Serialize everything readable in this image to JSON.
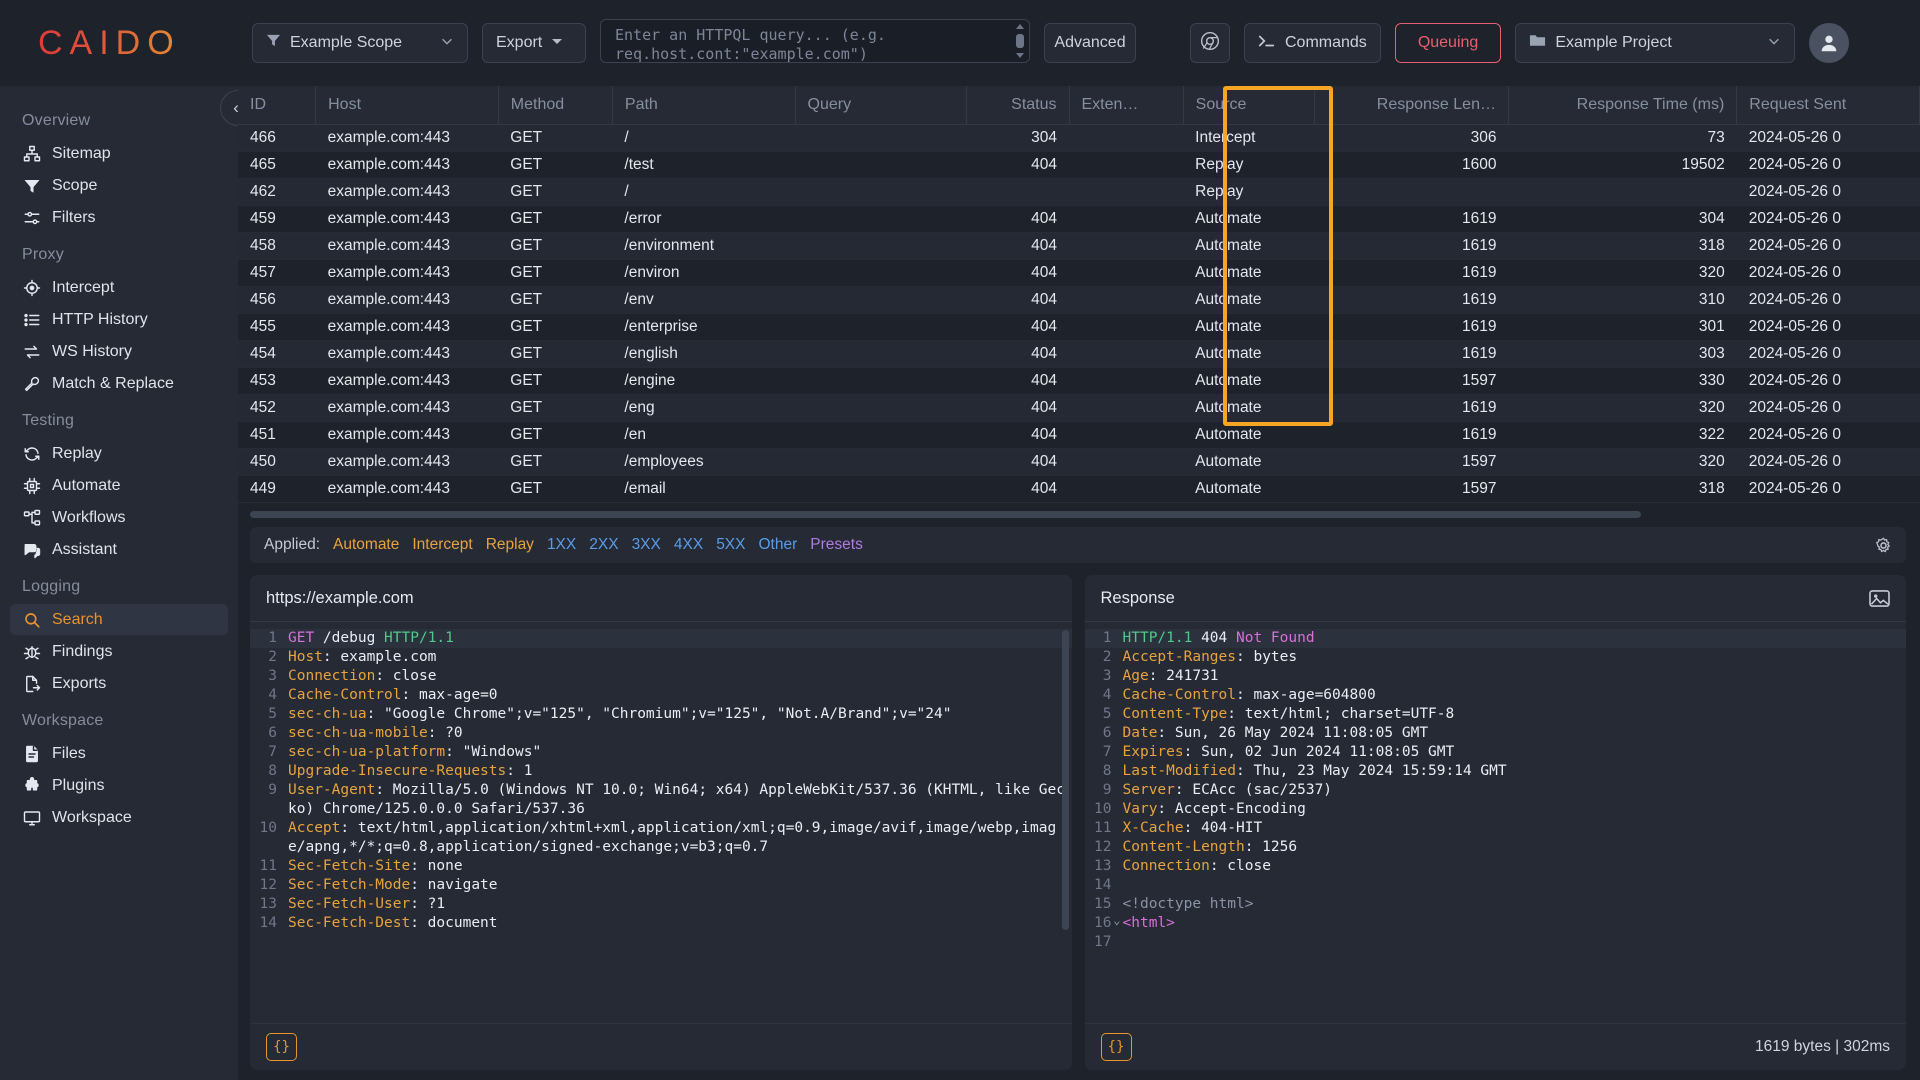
{
  "topbar": {
    "logo": "CAIDO",
    "scope": {
      "label": "Example Scope",
      "icon": "filter-icon"
    },
    "export": {
      "label": "Export"
    },
    "search": {
      "placeholder": "Enter an HTTPQL query... (e.g. req.host.cont:\"example.com\")",
      "value": ""
    },
    "advanced": {
      "label": "Advanced"
    },
    "browser": {
      "icon": "chrome-icon"
    },
    "commands": {
      "label": "Commands",
      "icon": "terminal-icon"
    },
    "queuing": {
      "label": "Queuing",
      "color": "#e8606f"
    },
    "project": {
      "label": "Example Project",
      "icon": "folder-icon"
    },
    "account": {
      "icon": "user-avatar-icon"
    }
  },
  "sidebar": {
    "collapse": "«",
    "groups": [
      {
        "title": "Overview",
        "items": [
          {
            "label": "Sitemap",
            "icon": "sitemap-icon",
            "active": false
          },
          {
            "label": "Scope",
            "icon": "filter-icon",
            "active": false
          },
          {
            "label": "Filters",
            "icon": "sliders-icon",
            "active": false
          }
        ]
      },
      {
        "title": "Proxy",
        "items": [
          {
            "label": "Intercept",
            "icon": "target-icon",
            "active": false
          },
          {
            "label": "HTTP History",
            "icon": "list-icon",
            "active": false
          },
          {
            "label": "WS History",
            "icon": "exchange-icon",
            "active": false
          },
          {
            "label": "Match & Replace",
            "icon": "wrench-icon",
            "active": false
          }
        ]
      },
      {
        "title": "Testing",
        "items": [
          {
            "label": "Replay",
            "icon": "refresh-icon",
            "active": false
          },
          {
            "label": "Automate",
            "icon": "chip-icon",
            "active": false
          },
          {
            "label": "Workflows",
            "icon": "workflow-icon",
            "active": false
          },
          {
            "label": "Assistant",
            "icon": "chat-icon",
            "active": false
          }
        ]
      },
      {
        "title": "Logging",
        "items": [
          {
            "label": "Search",
            "icon": "search-icon",
            "active": true
          },
          {
            "label": "Findings",
            "icon": "bug-icon",
            "active": false
          },
          {
            "label": "Exports",
            "icon": "file-export-icon",
            "active": false
          }
        ]
      },
      {
        "title": "Workspace",
        "items": [
          {
            "label": "Files",
            "icon": "file-icon",
            "active": false
          },
          {
            "label": "Plugins",
            "icon": "puzzle-icon",
            "active": false
          },
          {
            "label": "Workspace",
            "icon": "monitor-icon",
            "active": false
          }
        ]
      }
    ]
  },
  "table": {
    "columns": [
      "ID",
      "Host",
      "Method",
      "Path",
      "Query",
      "Status",
      "Exten…",
      "Source",
      "Response Len…",
      "Response Time (ms)",
      "Request Sent"
    ],
    "highlighted_column": "Source",
    "highlight_color": "#f5a623",
    "rows": [
      {
        "id": "466",
        "host": "example.com:443",
        "method": "GET",
        "path": "/",
        "query": "",
        "status": "304",
        "ext": "",
        "source": "Intercept",
        "resp_len": "306",
        "resp_time": "73",
        "sent": "2024-05-26 0"
      },
      {
        "id": "465",
        "host": "example.com:443",
        "method": "GET",
        "path": "/test",
        "query": "",
        "status": "404",
        "ext": "",
        "source": "Replay",
        "resp_len": "1600",
        "resp_time": "19502",
        "sent": "2024-05-26 0"
      },
      {
        "id": "462",
        "host": "example.com:443",
        "method": "GET",
        "path": "/",
        "query": "",
        "status": "",
        "ext": "",
        "source": "Replay",
        "resp_len": "",
        "resp_time": "",
        "sent": "2024-05-26 0"
      },
      {
        "id": "459",
        "host": "example.com:443",
        "method": "GET",
        "path": "/error",
        "query": "",
        "status": "404",
        "ext": "",
        "source": "Automate",
        "resp_len": "1619",
        "resp_time": "304",
        "sent": "2024-05-26 0"
      },
      {
        "id": "458",
        "host": "example.com:443",
        "method": "GET",
        "path": "/environment",
        "query": "",
        "status": "404",
        "ext": "",
        "source": "Automate",
        "resp_len": "1619",
        "resp_time": "318",
        "sent": "2024-05-26 0"
      },
      {
        "id": "457",
        "host": "example.com:443",
        "method": "GET",
        "path": "/environ",
        "query": "",
        "status": "404",
        "ext": "",
        "source": "Automate",
        "resp_len": "1619",
        "resp_time": "320",
        "sent": "2024-05-26 0"
      },
      {
        "id": "456",
        "host": "example.com:443",
        "method": "GET",
        "path": "/env",
        "query": "",
        "status": "404",
        "ext": "",
        "source": "Automate",
        "resp_len": "1619",
        "resp_time": "310",
        "sent": "2024-05-26 0"
      },
      {
        "id": "455",
        "host": "example.com:443",
        "method": "GET",
        "path": "/enterprise",
        "query": "",
        "status": "404",
        "ext": "",
        "source": "Automate",
        "resp_len": "1619",
        "resp_time": "301",
        "sent": "2024-05-26 0"
      },
      {
        "id": "454",
        "host": "example.com:443",
        "method": "GET",
        "path": "/english",
        "query": "",
        "status": "404",
        "ext": "",
        "source": "Automate",
        "resp_len": "1619",
        "resp_time": "303",
        "sent": "2024-05-26 0"
      },
      {
        "id": "453",
        "host": "example.com:443",
        "method": "GET",
        "path": "/engine",
        "query": "",
        "status": "404",
        "ext": "",
        "source": "Automate",
        "resp_len": "1597",
        "resp_time": "330",
        "sent": "2024-05-26 0"
      },
      {
        "id": "452",
        "host": "example.com:443",
        "method": "GET",
        "path": "/eng",
        "query": "",
        "status": "404",
        "ext": "",
        "source": "Automate",
        "resp_len": "1619",
        "resp_time": "320",
        "sent": "2024-05-26 0"
      },
      {
        "id": "451",
        "host": "example.com:443",
        "method": "GET",
        "path": "/en",
        "query": "",
        "status": "404",
        "ext": "",
        "source": "Automate",
        "resp_len": "1619",
        "resp_time": "322",
        "sent": "2024-05-26 0"
      },
      {
        "id": "450",
        "host": "example.com:443",
        "method": "GET",
        "path": "/employees",
        "query": "",
        "status": "404",
        "ext": "",
        "source": "Automate",
        "resp_len": "1597",
        "resp_time": "320",
        "sent": "2024-05-26 0"
      },
      {
        "id": "449",
        "host": "example.com:443",
        "method": "GET",
        "path": "/email",
        "query": "",
        "status": "404",
        "ext": "",
        "source": "Automate",
        "resp_len": "1597",
        "resp_time": "318",
        "sent": "2024-05-26 0"
      }
    ]
  },
  "applied": {
    "label": "Applied:",
    "tags": [
      {
        "text": "Automate",
        "color": "#e8a33d"
      },
      {
        "text": "Intercept",
        "color": "#e8a33d"
      },
      {
        "text": "Replay",
        "color": "#e8a33d"
      },
      {
        "text": "1XX",
        "color": "#5b9ce6"
      },
      {
        "text": "2XX",
        "color": "#5b9ce6"
      },
      {
        "text": "3XX",
        "color": "#5b9ce6"
      },
      {
        "text": "4XX",
        "color": "#5b9ce6"
      },
      {
        "text": "5XX",
        "color": "#5b9ce6"
      },
      {
        "text": "Other",
        "color": "#5b9ce6"
      },
      {
        "text": "Presets",
        "color": "#b07be0"
      }
    ],
    "settings_icon": "gear-icon"
  },
  "request": {
    "title": "https://example.com",
    "lines": [
      {
        "n": "1",
        "parts": [
          {
            "t": "GET",
            "c": "k-meth"
          },
          {
            "t": " /debug ",
            "c": "k-path"
          },
          {
            "t": "HTTP/1.1",
            "c": "k-ver"
          }
        ]
      },
      {
        "n": "2",
        "parts": [
          {
            "t": "Host",
            "c": "k-hdr"
          },
          {
            "t": ": example.com",
            "c": "k-val"
          }
        ]
      },
      {
        "n": "3",
        "parts": [
          {
            "t": "Connection",
            "c": "k-hdr"
          },
          {
            "t": ": close",
            "c": "k-val"
          }
        ]
      },
      {
        "n": "4",
        "parts": [
          {
            "t": "Cache-Control",
            "c": "k-hdr"
          },
          {
            "t": ": max-age=0",
            "c": "k-val"
          }
        ]
      },
      {
        "n": "5",
        "parts": [
          {
            "t": "sec-ch-ua",
            "c": "k-hdr"
          },
          {
            "t": ": \"Google Chrome\";v=\"125\", \"Chromium\";v=\"125\", \"Not.A/Brand\";v=\"24\"",
            "c": "k-val"
          }
        ]
      },
      {
        "n": "6",
        "parts": [
          {
            "t": "sec-ch-ua-mobile",
            "c": "k-hdr"
          },
          {
            "t": ": ?0",
            "c": "k-val"
          }
        ]
      },
      {
        "n": "7",
        "parts": [
          {
            "t": "sec-ch-ua-platform",
            "c": "k-hdr"
          },
          {
            "t": ": \"Windows\"",
            "c": "k-val"
          }
        ]
      },
      {
        "n": "8",
        "parts": [
          {
            "t": "Upgrade-Insecure-Requests",
            "c": "k-hdr"
          },
          {
            "t": ": 1",
            "c": "k-val"
          }
        ]
      },
      {
        "n": "9",
        "parts": [
          {
            "t": "User-Agent",
            "c": "k-hdr"
          },
          {
            "t": ": Mozilla/5.0 (Windows NT 10.0; Win64; x64) AppleWebKit/537.36 (KHTML, like Gecko) Chrome/125.0.0.0 Safari/537.36",
            "c": "k-val"
          }
        ]
      },
      {
        "n": "10",
        "parts": [
          {
            "t": "Accept",
            "c": "k-hdr"
          },
          {
            "t": ": text/html,application/xhtml+xml,application/xml;q=0.9,image/avif,image/webp,image/apng,*/*;q=0.8,application/signed-exchange;v=b3;q=0.7",
            "c": "k-val"
          }
        ]
      },
      {
        "n": "11",
        "parts": [
          {
            "t": "Sec-Fetch-Site",
            "c": "k-hdr"
          },
          {
            "t": ": none",
            "c": "k-val"
          }
        ]
      },
      {
        "n": "12",
        "parts": [
          {
            "t": "Sec-Fetch-Mode",
            "c": "k-hdr"
          },
          {
            "t": ": navigate",
            "c": "k-val"
          }
        ]
      },
      {
        "n": "13",
        "parts": [
          {
            "t": "Sec-Fetch-User",
            "c": "k-hdr"
          },
          {
            "t": ": ?1",
            "c": "k-val"
          }
        ]
      },
      {
        "n": "14",
        "parts": [
          {
            "t": "Sec-Fetch-Dest",
            "c": "k-hdr"
          },
          {
            "t": ": document",
            "c": "k-val"
          }
        ]
      }
    ],
    "pretty_button": "{}"
  },
  "response": {
    "title": "Response",
    "image_icon": "image-icon",
    "lines": [
      {
        "n": "1",
        "parts": [
          {
            "t": "HTTP/1.1",
            "c": "k-ver"
          },
          {
            "t": " 404 ",
            "c": "k-stat"
          },
          {
            "t": "Not Found",
            "c": "k-txt"
          }
        ]
      },
      {
        "n": "2",
        "parts": [
          {
            "t": "Accept-Ranges",
            "c": "k-hdr"
          },
          {
            "t": ": bytes",
            "c": "k-val"
          }
        ]
      },
      {
        "n": "3",
        "parts": [
          {
            "t": "Age",
            "c": "k-hdr"
          },
          {
            "t": ": 241731",
            "c": "k-val"
          }
        ]
      },
      {
        "n": "4",
        "parts": [
          {
            "t": "Cache-Control",
            "c": "k-hdr"
          },
          {
            "t": ": max-age=604800",
            "c": "k-val"
          }
        ]
      },
      {
        "n": "5",
        "parts": [
          {
            "t": "Content-Type",
            "c": "k-hdr"
          },
          {
            "t": ": text/html; charset=UTF-8",
            "c": "k-val"
          }
        ]
      },
      {
        "n": "6",
        "parts": [
          {
            "t": "Date",
            "c": "k-hdr"
          },
          {
            "t": ": Sun, 26 May 2024 11:08:05 GMT",
            "c": "k-val"
          }
        ]
      },
      {
        "n": "7",
        "parts": [
          {
            "t": "Expires",
            "c": "k-hdr"
          },
          {
            "t": ": Sun, 02 Jun 2024 11:08:05 GMT",
            "c": "k-val"
          }
        ]
      },
      {
        "n": "8",
        "parts": [
          {
            "t": "Last-Modified",
            "c": "k-hdr"
          },
          {
            "t": ": Thu, 23 May 2024 15:59:14 GMT",
            "c": "k-val"
          }
        ]
      },
      {
        "n": "9",
        "parts": [
          {
            "t": "Server",
            "c": "k-hdr"
          },
          {
            "t": ": ECAcc (sac/2537)",
            "c": "k-val"
          }
        ]
      },
      {
        "n": "10",
        "parts": [
          {
            "t": "Vary",
            "c": "k-hdr"
          },
          {
            "t": ": Accept-Encoding",
            "c": "k-val"
          }
        ]
      },
      {
        "n": "11",
        "parts": [
          {
            "t": "X-Cache",
            "c": "k-hdr"
          },
          {
            "t": ": 404-HIT",
            "c": "k-val"
          }
        ]
      },
      {
        "n": "12",
        "parts": [
          {
            "t": "Content-Length",
            "c": "k-hdr"
          },
          {
            "t": ": 1256",
            "c": "k-val"
          }
        ]
      },
      {
        "n": "13",
        "parts": [
          {
            "t": "Connection",
            "c": "k-hdr"
          },
          {
            "t": ": close",
            "c": "k-val"
          }
        ]
      },
      {
        "n": "14",
        "parts": [
          {
            "t": "",
            "c": "k-val"
          }
        ]
      },
      {
        "n": "15",
        "parts": [
          {
            "t": "<!doctype html>",
            "c": "k-tag"
          }
        ]
      },
      {
        "n": "16",
        "parts": [
          {
            "t": "<html>",
            "c": "k-tag2"
          }
        ],
        "fold": true
      },
      {
        "n": "17",
        "parts": [
          {
            "t": "",
            "c": "k-val"
          }
        ]
      }
    ],
    "pretty_button": "{}",
    "meta": "1619 bytes  |  302ms"
  }
}
